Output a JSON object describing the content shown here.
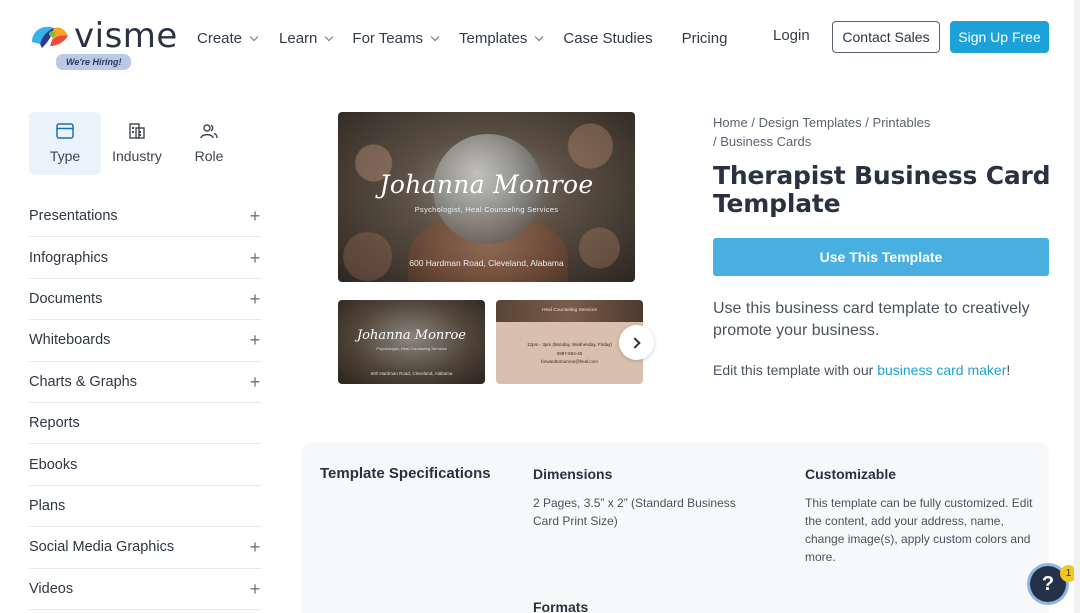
{
  "brand": {
    "logo_text": "visme",
    "hiring_badge": "We're Hiring!"
  },
  "nav": {
    "items": [
      {
        "label": "Create",
        "dropdown": true
      },
      {
        "label": "Learn",
        "dropdown": true
      },
      {
        "label": "For Teams",
        "dropdown": true
      },
      {
        "label": "Templates",
        "dropdown": true
      },
      {
        "label": "Case Studies",
        "dropdown": false
      },
      {
        "label": "Pricing",
        "dropdown": false
      }
    ],
    "login": "Login",
    "contact_sales": "Contact Sales",
    "sign_up": "Sign Up Free"
  },
  "filters": {
    "tabs": [
      {
        "label": "Type",
        "icon": "window-icon",
        "active": true
      },
      {
        "label": "Industry",
        "icon": "building-icon",
        "active": false
      },
      {
        "label": "Role",
        "icon": "users-icon",
        "active": false
      }
    ]
  },
  "categories": [
    {
      "label": "Presentations",
      "expandable": true
    },
    {
      "label": "Infographics",
      "expandable": true
    },
    {
      "label": "Documents",
      "expandable": true
    },
    {
      "label": "Whiteboards",
      "expandable": true
    },
    {
      "label": "Charts & Graphs",
      "expandable": true
    },
    {
      "label": "Reports",
      "expandable": false
    },
    {
      "label": "Ebooks",
      "expandable": false
    },
    {
      "label": "Plans",
      "expandable": false
    },
    {
      "label": "Social Media Graphics",
      "expandable": true
    },
    {
      "label": "Videos",
      "expandable": true
    }
  ],
  "preview": {
    "name": "Johanna Monroe",
    "subtitle": "Psychologist, Heal Counseling Services",
    "address": "600 Hardman Road, Cleveland, Alabama",
    "thumb_front_name": "Johanna Monroe",
    "thumb_front_sub": "Psychologist, Heal Counseling Services",
    "thumb_front_addr": "600 Hardman Road, Cleveland, Alabama",
    "thumb_back_title": "Heal Counseling Services",
    "thumb_back_hours": "12pm - 3pm (Monday, Wednesday, Friday)",
    "thumb_back_phone": "0987-654-45",
    "thumb_back_email": "forwardtomunroe@heal.com"
  },
  "breadcrumb": {
    "home": "Home",
    "design_templates": "Design Templates",
    "printables": "Printables",
    "business_cards": "Business Cards",
    "separator": "/"
  },
  "detail": {
    "title": "Therapist Business Card Template",
    "use_button": "Use This Template",
    "description": "Use this business card template to creatively promote your business.",
    "edit_prefix": "Edit this template with our ",
    "edit_link": "business card maker",
    "edit_suffix": "!"
  },
  "specs": {
    "heading": "Template Specifications",
    "dimensions_title": "Dimensions",
    "dimensions_text": "2 Pages, 3.5” x 2” (Standard Business Card Print Size)",
    "customizable_title": "Customizable",
    "customizable_text": "This template can be fully customized. Edit the content, add your address, name, change image(s), apply custom colors and more.",
    "formats_title": "Formats"
  },
  "help": {
    "label": "?",
    "badge": "1"
  },
  "colors": {
    "accent": "#1da1d9",
    "use_button": "#48afe0",
    "help_bg": "#253149",
    "badge": "#f3c623"
  }
}
